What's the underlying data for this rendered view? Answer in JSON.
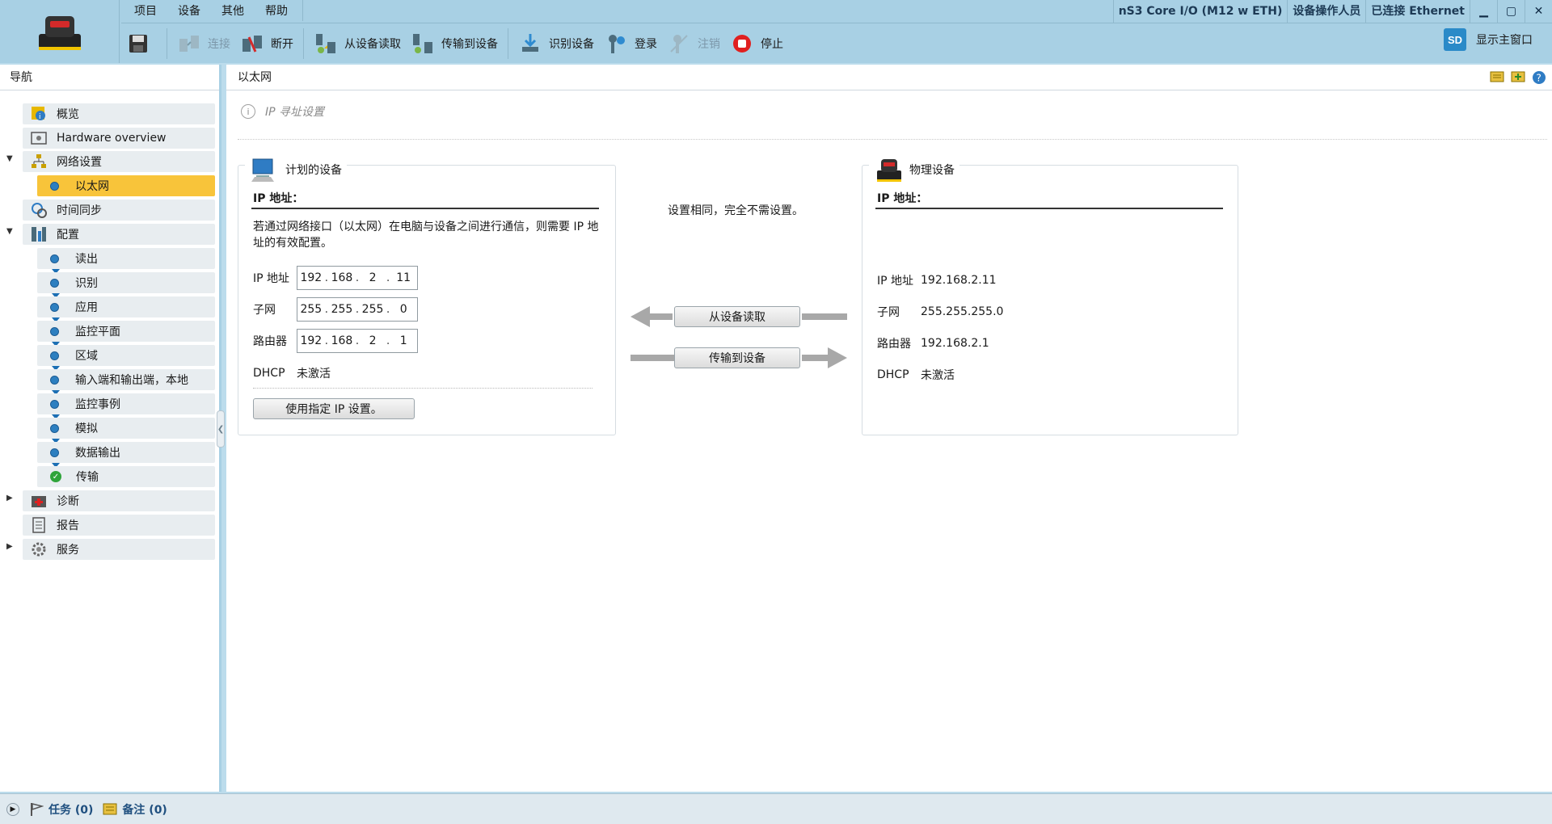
{
  "menu": [
    "项目",
    "设备",
    "其他",
    "帮助"
  ],
  "status_top": {
    "device_name": "nS3 Core I/O (M12 w ETH)",
    "role": "设备操作人员",
    "connection": "已连接 Ethernet"
  },
  "window_controls": {
    "minimize": "▁",
    "maximize": "▢",
    "close": "✕"
  },
  "toolbar": {
    "connect": "连接",
    "disconnect": "断开",
    "read_from_device": "从设备读取",
    "transfer_to_device": "传输到设备",
    "identify_device": "识别设备",
    "login": "登录",
    "logout": "注销",
    "stop": "停止",
    "show_main_window": "显示主窗口",
    "sd_badge": "SD"
  },
  "nav": {
    "header": "导航",
    "items": [
      {
        "label": "概览",
        "level": 0
      },
      {
        "label": "Hardware overview",
        "level": 0
      },
      {
        "label": "网络设置",
        "level": 0
      },
      {
        "label": "以太网",
        "level": 1
      },
      {
        "label": "时间同步",
        "level": 0
      },
      {
        "label": "配置",
        "level": 0
      },
      {
        "label": "读出",
        "level": 1
      },
      {
        "label": "识别",
        "level": 1
      },
      {
        "label": "应用",
        "level": 1
      },
      {
        "label": "监控平面",
        "level": 1
      },
      {
        "label": "区域",
        "level": 1
      },
      {
        "label": "输入端和输出端，本地",
        "level": 1
      },
      {
        "label": "监控事例",
        "level": 1
      },
      {
        "label": "模拟",
        "level": 1
      },
      {
        "label": "数据输出",
        "level": 1
      },
      {
        "label": "传输",
        "level": 1
      },
      {
        "label": "诊断",
        "level": 0
      },
      {
        "label": "报告",
        "level": 0
      },
      {
        "label": "服务",
        "level": 0
      }
    ]
  },
  "main": {
    "title": "以太网",
    "info": "IP 寻址设置",
    "planned": {
      "title": "计划的设备",
      "ip_heading": "IP 地址：",
      "description": "若通过网络接口（以太网）在电脑与设备之间进行通信，则需要 IP 地址的有效配置。",
      "ip_label": "IP 地址",
      "ip": [
        "192",
        "168",
        "2",
        "11"
      ],
      "subnet_label": "子网",
      "subnet": [
        "255",
        "255",
        "255",
        "0"
      ],
      "router_label": "路由器",
      "router": [
        "192",
        "168",
        "2",
        "1"
      ],
      "dhcp_label": "DHCP",
      "dhcp_value": "未激活",
      "apply_button": "使用指定 IP 设置。"
    },
    "middle": {
      "message": "设置相同，完全不需设置。",
      "read_button": "从设备读取",
      "transfer_button": "传输到设备"
    },
    "physical": {
      "title": "物理设备",
      "ip_heading": "IP 地址：",
      "ip_label": "IP 地址",
      "ip": "192.168.2.11",
      "subnet_label": "子网",
      "subnet": "255.255.255.0",
      "router_label": "路由器",
      "router": "192.168.2.1",
      "dhcp_label": "DHCP",
      "dhcp_value": "未激活"
    }
  },
  "bottom": {
    "tasks": "任务 (0)",
    "notes": "备注 (0)"
  }
}
